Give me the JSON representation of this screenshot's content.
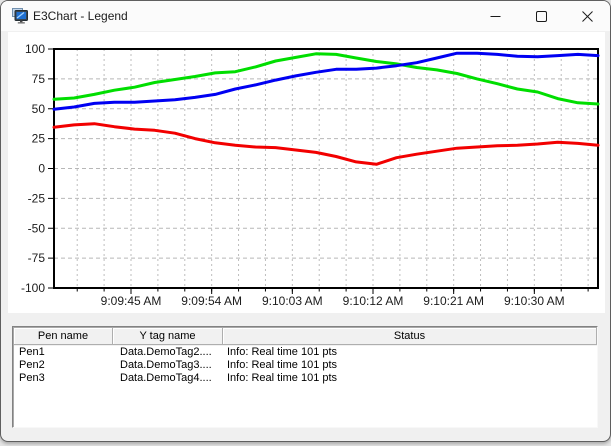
{
  "window": {
    "title": "E3Chart - Legend"
  },
  "chart_data": {
    "type": "line",
    "title": "",
    "xlabel": "",
    "ylabel": "",
    "grid": true,
    "ylim": [
      -100,
      100
    ],
    "y_ticks": [
      100,
      75,
      50,
      25,
      0,
      -25,
      -50,
      -75,
      -100
    ],
    "x_tick_labels": [
      "9:09:45 AM",
      "9:09:54 AM",
      "9:10:03 AM",
      "9:10:12 AM",
      "9:10:21 AM",
      "9:10:30 AM"
    ],
    "x_minor_per_major": 3,
    "series": [
      {
        "name": "Pen1",
        "color": "#f20000",
        "values": [
          34.5,
          36.5,
          37.5,
          35,
          33,
          32,
          29.5,
          25,
          21.5,
          19.5,
          18,
          17.5,
          15.5,
          13.5,
          10,
          5.5,
          3.5,
          9,
          12,
          14.5,
          17,
          18,
          19,
          19.5,
          20.5,
          22,
          21,
          19.5
        ]
      },
      {
        "name": "Pen2",
        "color": "#00de00",
        "values": [
          58,
          59,
          62,
          65.5,
          68,
          72,
          74.5,
          77,
          80,
          81,
          85,
          90,
          93,
          96,
          95.5,
          92.5,
          89.5,
          87.5,
          84.5,
          82.5,
          79.5,
          75,
          71,
          66.5,
          64,
          58.5,
          55,
          54
        ]
      },
      {
        "name": "Pen3",
        "color": "#0000f2",
        "values": [
          49.5,
          51.5,
          54.5,
          55.5,
          55.5,
          56.5,
          57.5,
          59.5,
          62,
          66.5,
          70,
          74,
          77.5,
          80.5,
          83,
          83,
          84,
          86,
          88.5,
          92.5,
          96.5,
          96.5,
          95.5,
          94,
          93.5,
          94.5,
          95.5,
          94.5
        ]
      }
    ]
  },
  "legend": {
    "headers": [
      "Pen name",
      "Y tag name",
      "Status"
    ],
    "rows": [
      {
        "pen": "Pen1",
        "tag": "Data.DemoTag2....",
        "status": "Info: Real time 101 pts"
      },
      {
        "pen": "Pen2",
        "tag": "Data.DemoTag3....",
        "status": "Info: Real time 101 pts"
      },
      {
        "pen": "Pen3",
        "tag": "Data.DemoTag4....",
        "status": "Info: Real time 101 pts"
      }
    ]
  }
}
